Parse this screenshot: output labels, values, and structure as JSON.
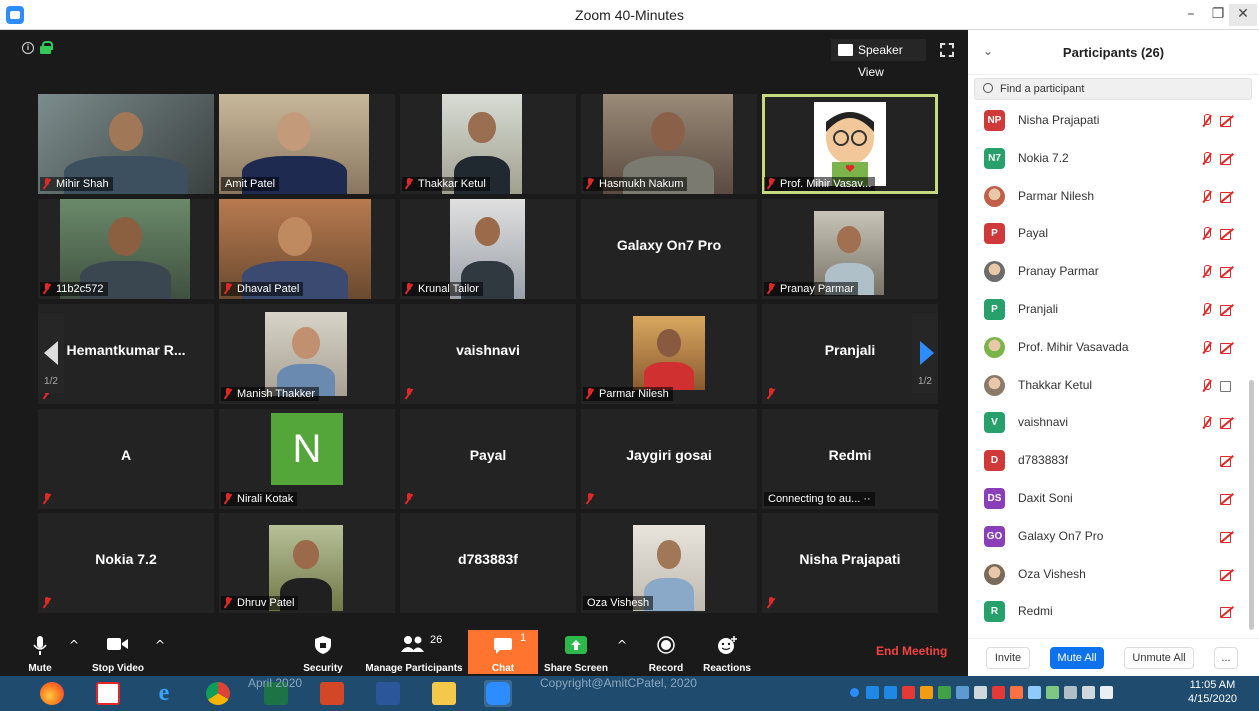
{
  "window": {
    "title": "Zoom 40-Minutes",
    "controls": [
      "–",
      "❐",
      "✕"
    ]
  },
  "video": {
    "speaker_view_label": "Speaker View",
    "page_left": "1/2",
    "page_right": "1/2",
    "tiles": [
      {
        "name": "Mihir Shah",
        "muted": true,
        "photo": true,
        "card": false
      },
      {
        "name": "Amit Patel",
        "muted": false,
        "photo": true,
        "card": false
      },
      {
        "name": "Thakkar Ketul",
        "muted": true,
        "photo": true,
        "card": false
      },
      {
        "name": "Hasmukh Nakum",
        "muted": true,
        "photo": true,
        "card": false
      },
      {
        "name": "Prof. Mihir Vasav...",
        "muted": true,
        "photo": true,
        "card": false,
        "active": true
      },
      {
        "name": "11b2c572",
        "muted": true,
        "photo": true,
        "card": false
      },
      {
        "name": "Dhaval Patel",
        "muted": true,
        "photo": true,
        "card": false
      },
      {
        "name": "Krunal Tailor",
        "muted": true,
        "photo": true,
        "card": false
      },
      {
        "name": "Galaxy On7 Pro",
        "muted": false,
        "photo": false,
        "card": true
      },
      {
        "name": "Pranay Parmar",
        "muted": true,
        "photo": true,
        "card": false
      },
      {
        "name": "Hemantkumar  R...",
        "muted": true,
        "photo": false,
        "card": true
      },
      {
        "name": "Manish Thakker",
        "muted": true,
        "photo": true,
        "card": false
      },
      {
        "name": "vaishnavi",
        "muted": true,
        "photo": false,
        "card": true
      },
      {
        "name": "Parmar Nilesh",
        "muted": true,
        "photo": true,
        "card": false
      },
      {
        "name": "Pranjali",
        "muted": true,
        "photo": false,
        "card": true
      },
      {
        "name": "A",
        "muted": true,
        "photo": false,
        "card": true
      },
      {
        "name": "Nirali Kotak",
        "muted": true,
        "photo": false,
        "card": false,
        "letter": "N"
      },
      {
        "name": "Payal",
        "muted": true,
        "photo": false,
        "card": true
      },
      {
        "name": "Jaygiri gosai",
        "muted": true,
        "photo": false,
        "card": true
      },
      {
        "name": "Redmi",
        "muted": false,
        "photo": false,
        "card": true,
        "status": "Connecting to au... ··"
      },
      {
        "name": "Nokia 7.2",
        "muted": true,
        "photo": false,
        "card": true
      },
      {
        "name": "Dhruv Patel",
        "muted": true,
        "photo": true,
        "card": false
      },
      {
        "name": "d783883f",
        "muted": false,
        "photo": false,
        "card": true
      },
      {
        "name": "Oza Vishesh",
        "muted": false,
        "photo": true,
        "card": false
      },
      {
        "name": "Nisha Prajapati",
        "muted": true,
        "photo": false,
        "card": true
      }
    ]
  },
  "toolbar": {
    "mute": "Mute",
    "stop_video": "Stop Video",
    "security": "Security",
    "manage_participants": "Manage Participants",
    "participant_count": "26",
    "chat": "Chat",
    "chat_badge": "1",
    "share_screen": "Share Screen",
    "record": "Record",
    "reactions": "Reactions",
    "end_meeting": "End Meeting"
  },
  "panel": {
    "title": "Participants (26)",
    "search_placeholder": "Find a participant",
    "participants": [
      {
        "initials": "NP",
        "name": "Nisha Prajapati",
        "color": "#d0393a",
        "muted": true,
        "video_off": true
      },
      {
        "initials": "N7",
        "name": "Nokia 7.2",
        "color": "#28a06b",
        "muted": true,
        "video_off": true
      },
      {
        "initials": "",
        "name": "Parmar Nilesh",
        "color": "#c0604a",
        "muted": true,
        "video_off": true
      },
      {
        "initials": "P",
        "name": "Payal",
        "color": "#d0393a",
        "muted": true,
        "video_off": true
      },
      {
        "initials": "",
        "name": "Pranay Parmar",
        "color": "#6c6c6c",
        "muted": true,
        "video_off": true
      },
      {
        "initials": "P",
        "name": "Pranjali",
        "color": "#28a06b",
        "muted": true,
        "video_off": true
      },
      {
        "initials": "",
        "name": "Prof. Mihir Vasavada",
        "color": "#7bb44a",
        "muted": true,
        "video_off": true
      },
      {
        "initials": "",
        "name": "Thakkar Ketul",
        "color": "#8a7a6a",
        "muted": true,
        "video_off": false
      },
      {
        "initials": "V",
        "name": "vaishnavi",
        "color": "#28a06b",
        "muted": true,
        "video_off": true
      },
      {
        "initials": "D",
        "name": "d783883f",
        "color": "#d0393a",
        "muted": false,
        "video_off": true
      },
      {
        "initials": "DS",
        "name": "Daxit Soni",
        "color": "#8a3fb8",
        "muted": false,
        "video_off": true
      },
      {
        "initials": "GO",
        "name": "Galaxy On7 Pro",
        "color": "#8a3fb8",
        "muted": false,
        "video_off": true
      },
      {
        "initials": "",
        "name": "Oza Vishesh",
        "color": "#7a6a5a",
        "muted": false,
        "video_off": true
      },
      {
        "initials": "R",
        "name": "Redmi",
        "color": "#28a06b",
        "muted": false,
        "video_off": true
      }
    ],
    "invite": "Invite",
    "mute_all": "Mute All",
    "unmute_all": "Unmute All",
    "more": "..."
  },
  "taskbar": {
    "time": "11:05 AM",
    "date": "4/15/2020",
    "watermark_left": "April 2020",
    "watermark_center": "Copyright@AmitCPatel, 2020"
  },
  "colors": {
    "accent": "#0e72ed",
    "chat": "#ff742e",
    "end": "#f54242",
    "active_speaker": "#c6d97f",
    "muted": "#e02828"
  }
}
